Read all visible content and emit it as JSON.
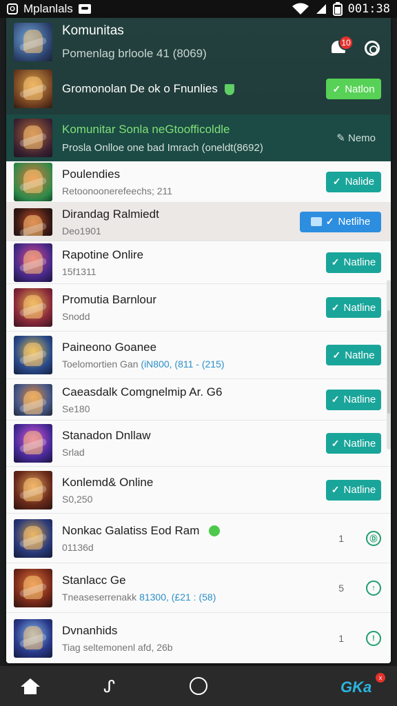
{
  "status_bar": {
    "app_name": "Mplanlals",
    "time": "001:38"
  },
  "header": {
    "title": "Komunitas",
    "subtitle": "Pomenlag brloole 41 (8069)",
    "notif_count": "10",
    "row2_title": "Gromonolan De ok o Fnunlies",
    "row2_button": "Natlon",
    "row3_title": "Komunitar Sonla neGtoofficoldle",
    "row3_sub": "Prosla Onlloe one bad Imrach (oneldt(8692)",
    "row3_button": "Nemo"
  },
  "list": [
    {
      "title": "Poulendies",
      "sub": "Retoonoonerefeechs; 211",
      "button": "Nalide",
      "variant": "teal"
    },
    {
      "title": "Dirandag Ralmiedt",
      "sub": "Deo1901",
      "button": "Netlihe",
      "variant": "blue"
    },
    {
      "title": "Rapotine Onlire",
      "sub": "15f1311",
      "button": "Natline",
      "variant": "teal"
    },
    {
      "title": "Promutia Barnlour",
      "sub": "Snodd",
      "button": "Natline",
      "variant": "teal"
    },
    {
      "title": "Paineono Goanee",
      "sub_a": "Toelomortien Gan ",
      "sub_b": "(iN800, (811 - (215)",
      "button": "Natlne",
      "variant": "teal"
    },
    {
      "title": "Caeasdalk Comgnelmip Ar. G6",
      "sub": "Se180",
      "button": "Natline",
      "variant": "teal"
    },
    {
      "title": "Stanadon Dnllaw",
      "sub": "Srlad",
      "button": "Natline",
      "variant": "teal"
    },
    {
      "title": "Konlemd& Online",
      "sub": "S0,250",
      "button": "Natline",
      "variant": "teal"
    },
    {
      "title": "Nonkac Galatiss Eod Ram",
      "sub": "01136d",
      "count": "1",
      "ring": "Ⓓ"
    },
    {
      "title": "Stanlacc Ge",
      "sub_a": "Tneaseserrenakk ",
      "sub_b": "81300, (£21 : (58)",
      "count": "5",
      "ring": "↑"
    },
    {
      "title": "Dvnanhids",
      "sub": "Tiag seltemonenl afd, 26b",
      "count": "1",
      "ring": "!"
    }
  ],
  "nav": {
    "app_label": "GKa",
    "app_badge": "x"
  },
  "colors": {
    "header_bg": "#23403e",
    "accent_teal": "#1aa59a",
    "accent_lime": "#57d156",
    "accent_blue": "#2d8ee0",
    "green_text": "#7fe07a"
  }
}
